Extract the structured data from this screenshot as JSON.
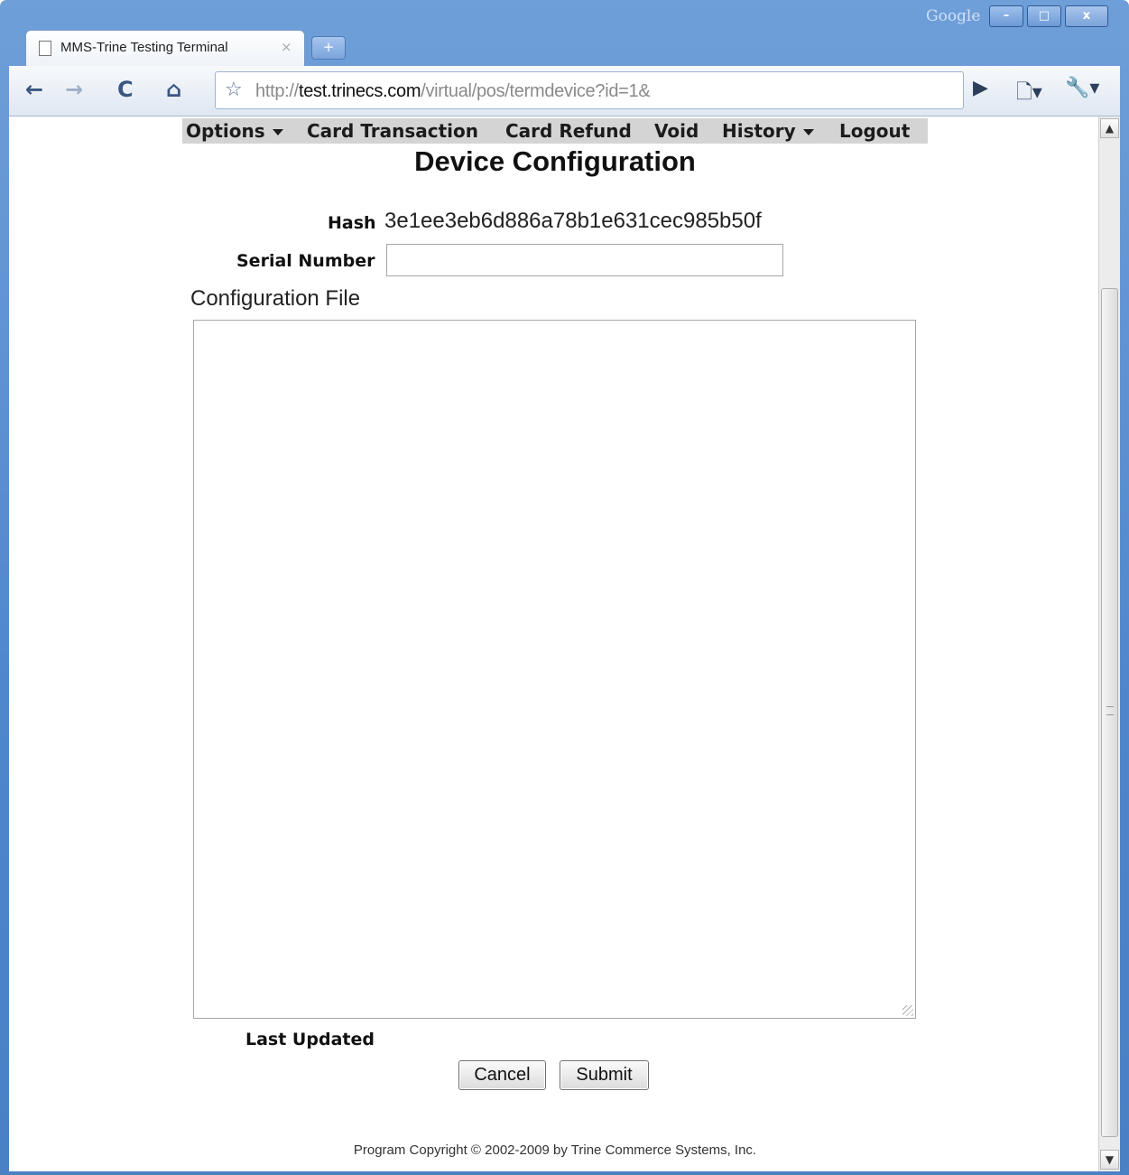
{
  "browser": {
    "search_brand": "Google",
    "window_buttons": {
      "minimize": "–",
      "maximize": "□",
      "close": "x"
    },
    "tab": {
      "title": "MMS-Trine Testing Terminal",
      "close": "×",
      "new_tab": "+"
    },
    "nav_icons": {
      "back": "←",
      "forward": "→",
      "reload": "C",
      "home": "⌂",
      "bookmark": "☆",
      "go": "▶",
      "page_menu": "🗋▾",
      "tools_menu": "🔧▾"
    },
    "address": {
      "scheme": "http://",
      "host": "test.trinecs.com",
      "path": "/virtual/pos/termdevice?id=1&"
    }
  },
  "menu": {
    "options": "Options",
    "card_transaction": "Card Transaction",
    "card_refund": "Card Refund",
    "void": "Void",
    "history": "History",
    "logout": "Logout"
  },
  "page": {
    "title": "Device Configuration",
    "hash_label": "Hash",
    "hash_value": "3e1ee3eb6d886a78b1e631cec985b50f",
    "serial_label": "Serial Number",
    "serial_value": "",
    "config_label": "Configuration File",
    "config_value": "",
    "last_updated_label": "Last Updated",
    "cancel_label": "Cancel",
    "submit_label": "Submit",
    "copyright": "Program Copyright © 2002-2009 by Trine Commerce Systems, Inc."
  },
  "scrollbar": {
    "up": "▲",
    "down": "▼"
  }
}
